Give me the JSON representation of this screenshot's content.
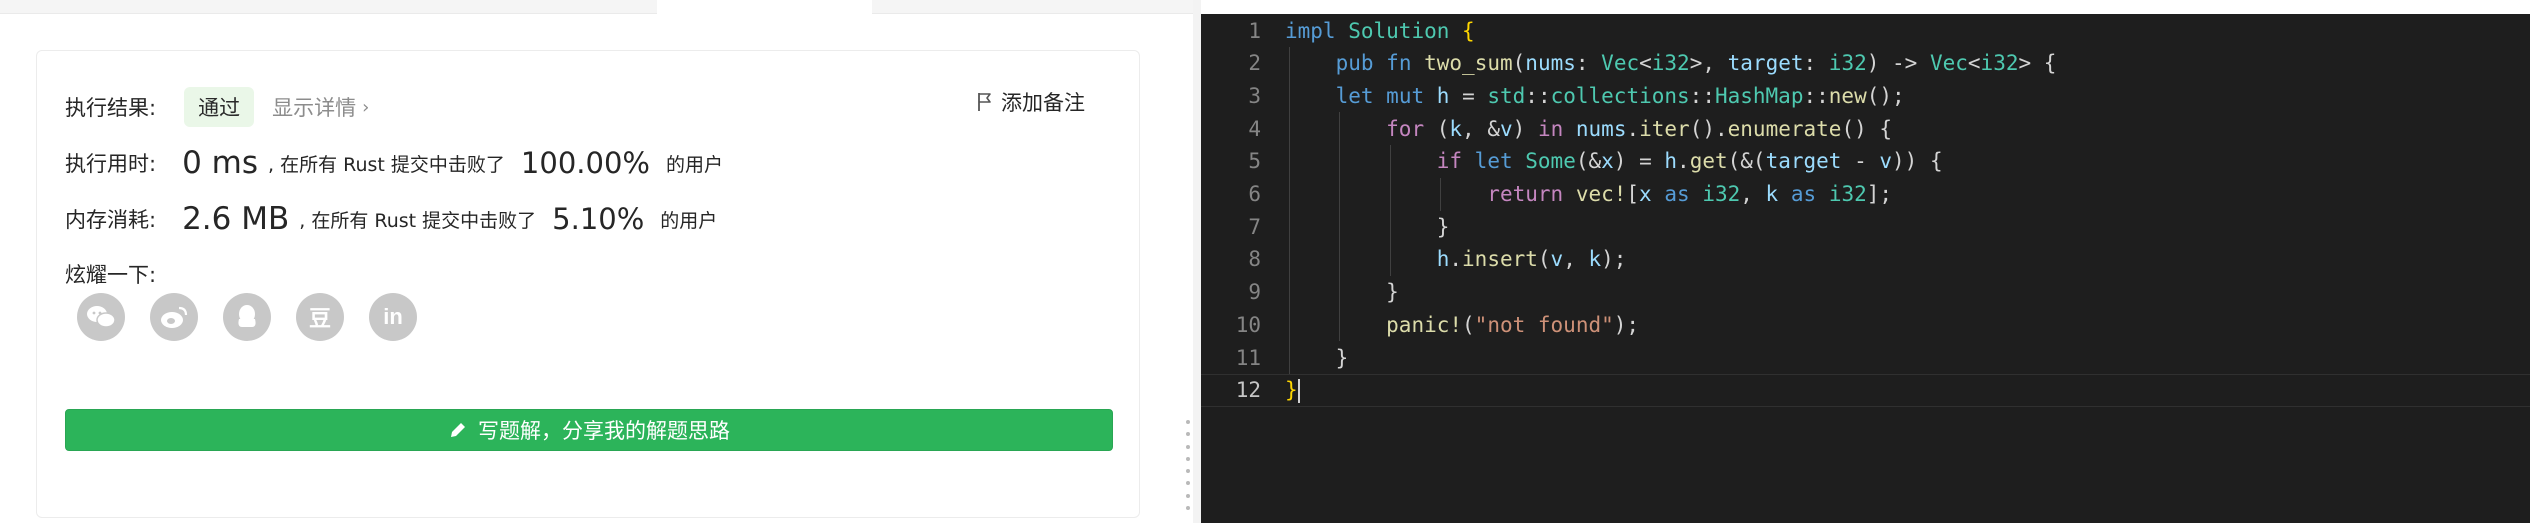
{
  "result": {
    "exec_result_label": "执行结果:",
    "status_badge": "通过",
    "show_details": "显示详情",
    "add_note": "添加备注",
    "runtime_label": "执行用时:",
    "runtime_value": "0 ms",
    "runtime_text": ", 在所有 Rust 提交中击败了",
    "runtime_percent": "100.00%",
    "runtime_users": "的用户",
    "memory_label": "内存消耗:",
    "memory_value": "2.6 MB",
    "memory_text": ", 在所有 Rust 提交中击败了",
    "memory_percent": "5.10%",
    "memory_users": "的用户",
    "share_label": "炫耀一下:",
    "share_icons": [
      "wechat-icon",
      "weibo-icon",
      "qq-icon",
      "douban-icon",
      "linkedin-icon"
    ],
    "share_glyphs": {
      "douban": "豆",
      "linkedin": "in"
    },
    "write_solution_button": "写题解，分享我的解题思路"
  },
  "colors": {
    "accent_green": "#2cb45a",
    "badge_bg": "#eaf7e8",
    "editor_bg": "#1e1e1e"
  },
  "editor": {
    "lines": [
      {
        "num": "1",
        "tokens": [
          {
            "t": "impl",
            "c": "kw"
          },
          {
            "t": " ",
            "c": "pn"
          },
          {
            "t": "Solution",
            "c": "ty"
          },
          {
            "t": " ",
            "c": "pn"
          },
          {
            "t": "{",
            "c": "br"
          }
        ]
      },
      {
        "num": "2",
        "tokens": [
          {
            "t": "    ",
            "c": "pn"
          },
          {
            "t": "pub",
            "c": "kw"
          },
          {
            "t": " ",
            "c": "pn"
          },
          {
            "t": "fn",
            "c": "kw"
          },
          {
            "t": " ",
            "c": "pn"
          },
          {
            "t": "two_sum",
            "c": "fn"
          },
          {
            "t": "(",
            "c": "pn"
          },
          {
            "t": "nums",
            "c": "vr"
          },
          {
            "t": ": ",
            "c": "pn"
          },
          {
            "t": "Vec",
            "c": "ty"
          },
          {
            "t": "<",
            "c": "pn"
          },
          {
            "t": "i32",
            "c": "ty"
          },
          {
            "t": ">, ",
            "c": "pn"
          },
          {
            "t": "target",
            "c": "vr"
          },
          {
            "t": ": ",
            "c": "pn"
          },
          {
            "t": "i32",
            "c": "ty"
          },
          {
            "t": ") -> ",
            "c": "pn"
          },
          {
            "t": "Vec",
            "c": "ty"
          },
          {
            "t": "<",
            "c": "pn"
          },
          {
            "t": "i32",
            "c": "ty"
          },
          {
            "t": "> {",
            "c": "pn"
          }
        ]
      },
      {
        "num": "3",
        "tokens": [
          {
            "t": "    ",
            "c": "pn"
          },
          {
            "t": "let",
            "c": "kw"
          },
          {
            "t": " ",
            "c": "pn"
          },
          {
            "t": "mut",
            "c": "kw"
          },
          {
            "t": " ",
            "c": "pn"
          },
          {
            "t": "h",
            "c": "vr"
          },
          {
            "t": " = ",
            "c": "pn"
          },
          {
            "t": "std",
            "c": "ty"
          },
          {
            "t": "::",
            "c": "pn"
          },
          {
            "t": "collections",
            "c": "ty"
          },
          {
            "t": "::",
            "c": "pn"
          },
          {
            "t": "HashMap",
            "c": "ty"
          },
          {
            "t": "::",
            "c": "pn"
          },
          {
            "t": "new",
            "c": "fn"
          },
          {
            "t": "();",
            "c": "pn"
          }
        ]
      },
      {
        "num": "4",
        "tokens": [
          {
            "t": "        ",
            "c": "pn"
          },
          {
            "t": "for",
            "c": "kw2"
          },
          {
            "t": " (",
            "c": "pn"
          },
          {
            "t": "k",
            "c": "vr"
          },
          {
            "t": ", &",
            "c": "pn"
          },
          {
            "t": "v",
            "c": "vr"
          },
          {
            "t": ") ",
            "c": "pn"
          },
          {
            "t": "in",
            "c": "kw2"
          },
          {
            "t": " ",
            "c": "pn"
          },
          {
            "t": "nums",
            "c": "vr"
          },
          {
            "t": ".",
            "c": "pn"
          },
          {
            "t": "iter",
            "c": "fn"
          },
          {
            "t": "().",
            "c": "pn"
          },
          {
            "t": "enumerate",
            "c": "fn"
          },
          {
            "t": "() {",
            "c": "pn"
          }
        ]
      },
      {
        "num": "5",
        "tokens": [
          {
            "t": "            ",
            "c": "pn"
          },
          {
            "t": "if",
            "c": "kw2"
          },
          {
            "t": " ",
            "c": "pn"
          },
          {
            "t": "let",
            "c": "kw"
          },
          {
            "t": " ",
            "c": "pn"
          },
          {
            "t": "Some",
            "c": "ty"
          },
          {
            "t": "(&",
            "c": "pn"
          },
          {
            "t": "x",
            "c": "vr"
          },
          {
            "t": ") = ",
            "c": "pn"
          },
          {
            "t": "h",
            "c": "vr"
          },
          {
            "t": ".",
            "c": "pn"
          },
          {
            "t": "get",
            "c": "fn"
          },
          {
            "t": "(&(",
            "c": "pn"
          },
          {
            "t": "target",
            "c": "vr"
          },
          {
            "t": " - ",
            "c": "pn"
          },
          {
            "t": "v",
            "c": "vr"
          },
          {
            "t": ")) {",
            "c": "pn"
          }
        ]
      },
      {
        "num": "6",
        "tokens": [
          {
            "t": "                ",
            "c": "pn"
          },
          {
            "t": "return",
            "c": "kw2"
          },
          {
            "t": " ",
            "c": "pn"
          },
          {
            "t": "vec!",
            "c": "fn"
          },
          {
            "t": "[",
            "c": "pn"
          },
          {
            "t": "x",
            "c": "vr"
          },
          {
            "t": " ",
            "c": "pn"
          },
          {
            "t": "as",
            "c": "kw"
          },
          {
            "t": " ",
            "c": "pn"
          },
          {
            "t": "i32",
            "c": "ty"
          },
          {
            "t": ", ",
            "c": "pn"
          },
          {
            "t": "k",
            "c": "vr"
          },
          {
            "t": " ",
            "c": "pn"
          },
          {
            "t": "as",
            "c": "kw"
          },
          {
            "t": " ",
            "c": "pn"
          },
          {
            "t": "i32",
            "c": "ty"
          },
          {
            "t": "];",
            "c": "pn"
          }
        ]
      },
      {
        "num": "7",
        "tokens": [
          {
            "t": "            }",
            "c": "pn"
          }
        ]
      },
      {
        "num": "8",
        "tokens": [
          {
            "t": "            ",
            "c": "pn"
          },
          {
            "t": "h",
            "c": "vr"
          },
          {
            "t": ".",
            "c": "pn"
          },
          {
            "t": "insert",
            "c": "fn"
          },
          {
            "t": "(",
            "c": "pn"
          },
          {
            "t": "v",
            "c": "vr"
          },
          {
            "t": ", ",
            "c": "pn"
          },
          {
            "t": "k",
            "c": "vr"
          },
          {
            "t": ");",
            "c": "pn"
          }
        ]
      },
      {
        "num": "9",
        "tokens": [
          {
            "t": "        }",
            "c": "pn"
          }
        ]
      },
      {
        "num": "10",
        "tokens": [
          {
            "t": "        ",
            "c": "pn"
          },
          {
            "t": "panic!",
            "c": "fn"
          },
          {
            "t": "(",
            "c": "pn"
          },
          {
            "t": "\"not found\"",
            "c": "st"
          },
          {
            "t": ");",
            "c": "pn"
          }
        ]
      },
      {
        "num": "11",
        "tokens": [
          {
            "t": "    }",
            "c": "pn"
          }
        ]
      },
      {
        "num": "12",
        "tokens": [
          {
            "t": "}",
            "c": "br"
          }
        ]
      }
    ]
  }
}
